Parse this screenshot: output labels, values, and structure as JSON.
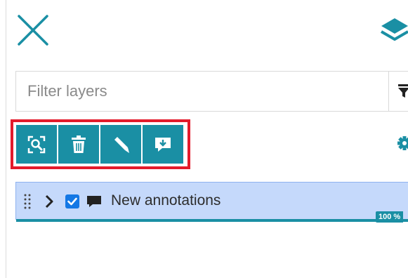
{
  "panel": {
    "close_icon": "close-x-icon",
    "layers_icon": "layers-stack-icon"
  },
  "filter": {
    "placeholder": "Filter layers",
    "value": "",
    "button_icon": "funnel-filter-icon"
  },
  "toolbar": {
    "highlighted": true,
    "highlight_color": "#e31b2b",
    "button_color": "#1a8fa4",
    "buttons": [
      {
        "name": "zoom-to-layer",
        "icon": "zoom-extent-icon"
      },
      {
        "name": "delete",
        "icon": "trash-icon"
      },
      {
        "name": "edit",
        "icon": "pencil-icon"
      },
      {
        "name": "import-annotations",
        "icon": "download-comment-icon"
      }
    ]
  },
  "settings_icon": "gear-icon",
  "layers": [
    {
      "name": "New annotations",
      "checked": true,
      "expanded": false,
      "type_icon": "comment-icon",
      "opacity": "100 %",
      "selected_color": "#c5d9fb"
    }
  ]
}
